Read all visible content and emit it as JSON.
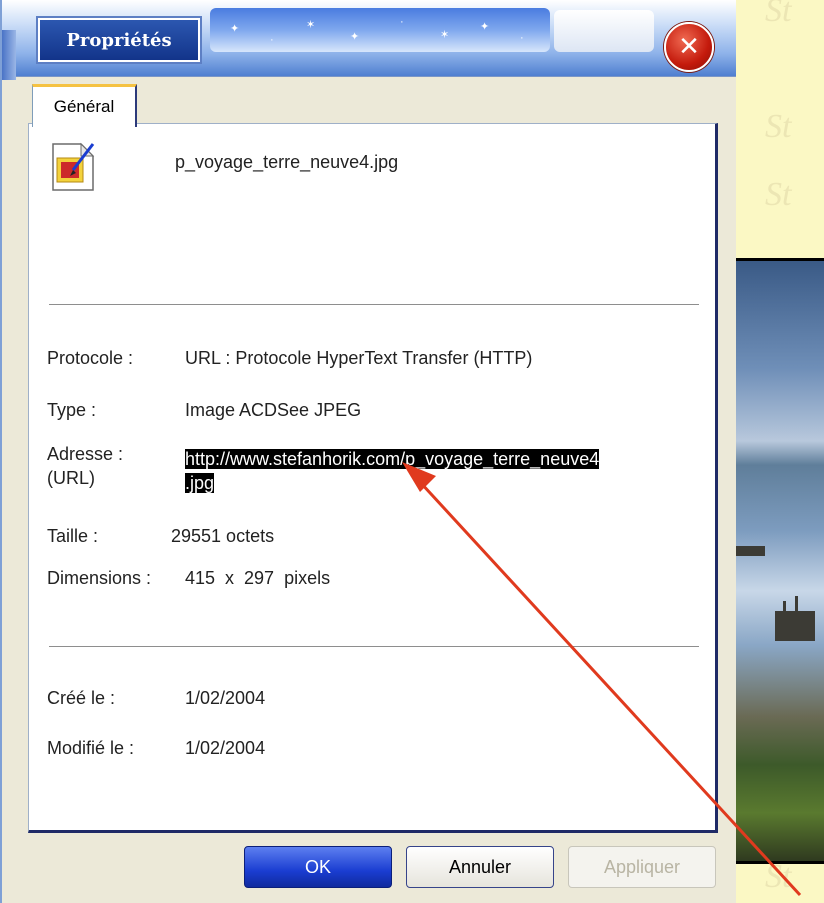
{
  "window": {
    "title": "Propriétés",
    "close_icon": "close-icon"
  },
  "tabs": [
    {
      "label": "Général",
      "active": true
    }
  ],
  "file": {
    "icon": "image-file-icon",
    "name": "p_voyage_terre_neuve4.jpg"
  },
  "properties": {
    "protocol": {
      "label": "Protocole :",
      "value": "URL : Protocole HyperText Transfer (HTTP)"
    },
    "type": {
      "label": "Type :",
      "value": "Image ACDSee JPEG"
    },
    "address": {
      "label_line1": "Adresse :",
      "label_line2": "(URL)",
      "value_line1": "http://www.stefanhorik.com/p_voyage_terre_neuve4",
      "value_line2": ".jpg"
    },
    "size": {
      "label": "Taille :",
      "value": "29551 octets"
    },
    "dimensions": {
      "label": "Dimensions :",
      "value": "415  x  297  pixels"
    }
  },
  "dates": {
    "created": {
      "label": "Créé le :",
      "value": "1/02/2004"
    },
    "modified": {
      "label": "Modifié le :",
      "value": "1/02/2004"
    }
  },
  "buttons": {
    "ok": "OK",
    "cancel": "Annuler",
    "apply": "Appliquer"
  },
  "annotation": {
    "arrow_color": "#e03a1e"
  },
  "colors": {
    "selection_bg": "#000000",
    "selection_fg": "#ffffff",
    "ok_button": "#1a3dd1",
    "close_button": "#c41a0c"
  }
}
